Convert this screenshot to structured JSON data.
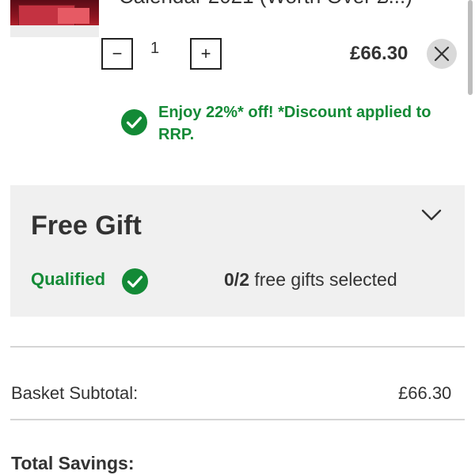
{
  "product": {
    "title_partial": "Calendar 2021 (Worth Over £...)",
    "quantity": "1",
    "minus_label": "−",
    "plus_label": "+",
    "price": "£66.30",
    "discount_message": "Enjoy 22%* off! *Discount applied to RRP."
  },
  "free_gift": {
    "title": "Free Gift",
    "qualified_label": "Qualified",
    "selected_count": "0",
    "selected_total": "2",
    "selected_text": "free gifts selected"
  },
  "summary": {
    "subtotal_label": "Basket Subtotal:",
    "subtotal_value": "£66.30",
    "savings_label": "Total Savings:"
  },
  "colors": {
    "accent_green": "#138a36",
    "panel_bg": "#f0f0f0"
  }
}
